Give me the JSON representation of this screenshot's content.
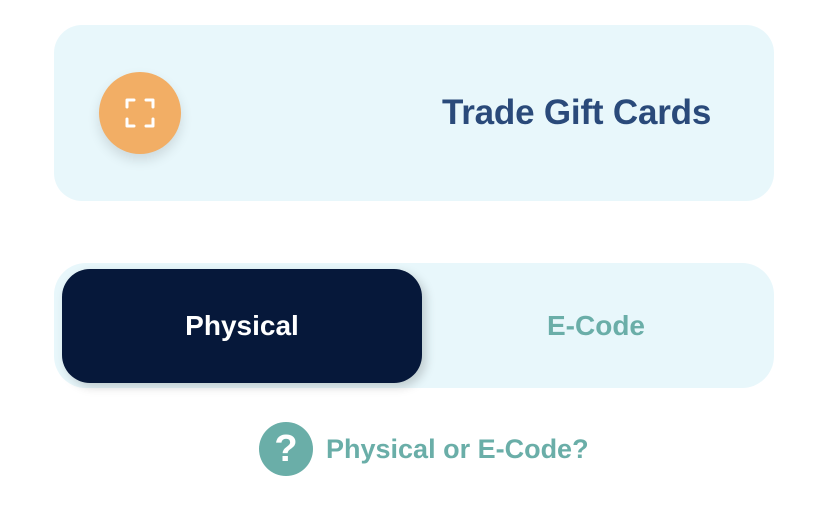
{
  "trade_card": {
    "title": "Trade Gift Cards",
    "scan_icon": "scan-frame-icon"
  },
  "toggle": {
    "options": [
      {
        "label": "Physical",
        "selected": true
      },
      {
        "label": "E-Code",
        "selected": false
      }
    ]
  },
  "help": {
    "icon": "question-mark-icon",
    "glyph": "?",
    "label": "Physical or E-Code?"
  },
  "colors": {
    "card_background": "#e8f7fb",
    "scan_button": "#f2ae65",
    "title_text": "#2a4a7a",
    "toggle_active_bg": "#06183a",
    "teal_accent": "#6aaea8"
  }
}
